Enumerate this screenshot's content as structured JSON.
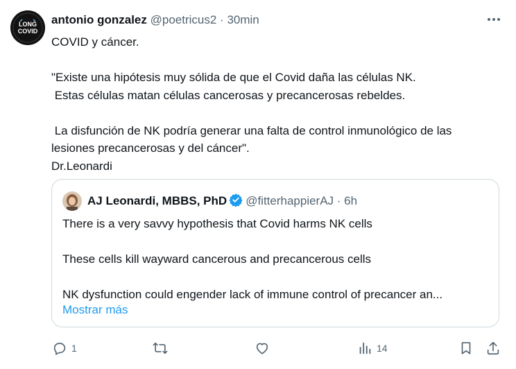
{
  "tweet": {
    "author_name": "antonio gonzalez",
    "handle": "@poetricus2",
    "separator": " · ",
    "time": "30min",
    "avatar_text_top": "LONG",
    "avatar_text_bottom": "COVID",
    "lines": [
      "COVID y cáncer.",
      "",
      "\"Existe una hipótesis muy sólida de que el Covid daña las células NK.",
      " Estas células matan células cancerosas y precancerosas rebeldes.",
      "",
      " La disfunción de NK podría generar una falta de control inmunológico de las",
      "lesiones precancerosas y del cáncer\".",
      "Dr.Leonardi"
    ]
  },
  "quote": {
    "author_name": "AJ Leonardi, MBBS, PhD",
    "handle": "@fitterhappierAJ",
    "separator": " · ",
    "time": "6h",
    "lines": [
      "There is a very savvy hypothesis that Covid harms NK cells",
      "",
      "These cells kill wayward cancerous and precancerous cells",
      "",
      "NK dysfunction could engender lack of immune control of precancer an..."
    ],
    "show_more": "Mostrar más"
  },
  "actions": {
    "reply_count": "1",
    "retweet_count": "",
    "like_count": "",
    "views_count": "14"
  },
  "colors": {
    "text": "#0f1419",
    "muted": "#536471",
    "link": "#1d9bf0",
    "border": "#cfd9de",
    "verified": "#1d9bf0"
  }
}
